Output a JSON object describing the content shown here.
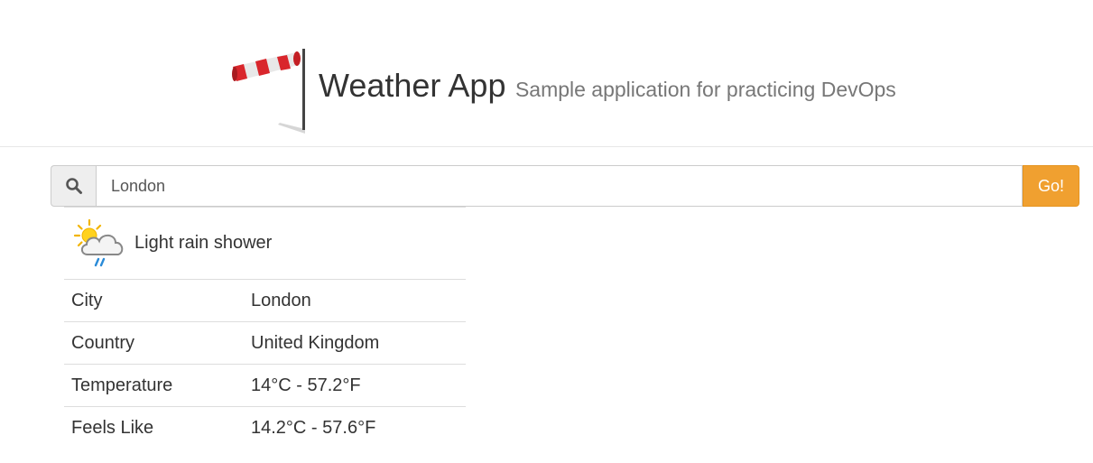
{
  "header": {
    "title": "Weather App",
    "subtitle": "Sample application for practicing DevOps",
    "logo_icon": "windsock-icon"
  },
  "search": {
    "icon": "search-icon",
    "value": "London",
    "button_label": "Go!",
    "button_color": "#f0a030"
  },
  "result": {
    "condition_icon": "sun-cloud-rain-icon",
    "condition": "Light rain shower",
    "rows": [
      {
        "label": "City",
        "value": "London"
      },
      {
        "label": "Country",
        "value": "United Kingdom"
      },
      {
        "label": "Temperature",
        "value": "14°C - 57.2°F"
      },
      {
        "label": "Feels Like",
        "value": "14.2°C - 57.6°F"
      }
    ]
  }
}
